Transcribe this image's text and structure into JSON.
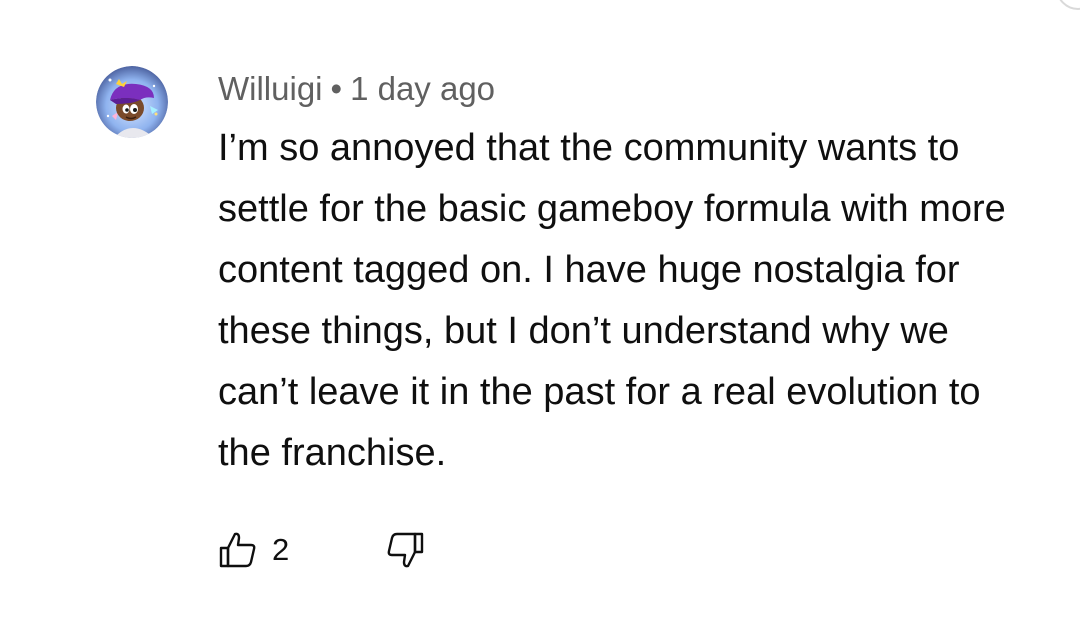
{
  "comment": {
    "author": "Willuigi",
    "separator": "•",
    "time": "1 day ago",
    "text": "I’m so annoyed that the community wants to settle for the basic gameboy formula with more content tagged on. I have huge nostalgia for these things, but I don’t understand why we can’t leave it in the past for a real evolution to the franchise.",
    "like_count": "2"
  },
  "icons": {
    "like": "thumb-up-icon",
    "dislike": "thumb-down-icon"
  },
  "colors": {
    "text": "#0f0f0f",
    "meta": "#606060",
    "avatar_hat": "#7b2fbe"
  }
}
